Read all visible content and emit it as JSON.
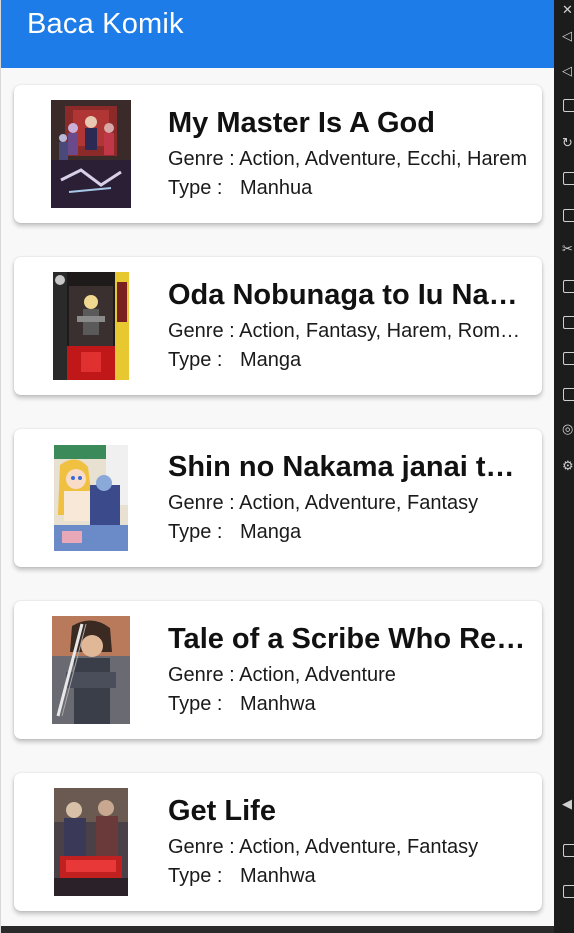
{
  "app": {
    "title": "Baca Komik",
    "accent_color": "#1e7ce8"
  },
  "labels": {
    "genre_prefix": "Genre : ",
    "type_label": "Type :"
  },
  "comics": [
    {
      "title": "My Master Is A God",
      "genre": "Action, Adventure, Ecchi, Harem",
      "type": "Manhua",
      "cover_icon": "cover-image-my-master-is-a-god"
    },
    {
      "title": "Oda Nobunaga to Iu Nazo no Shokugyou ga Mahou Kenshi yori Cheat datta node, Oukoku wo Tsukuru Koto ni Shimashita",
      "genre": "Action, Fantasy, Harem, Romance",
      "type": "Manga",
      "cover_icon": "cover-image-oda-nobunaga"
    },
    {
      "title": "Shin no Nakama janai to Yuusha no Party wo Oidasareta node",
      "genre": "Action, Adventure, Fantasy",
      "type": "Manga",
      "cover_icon": "cover-image-shin-no-nakama"
    },
    {
      "title": "Tale of a Scribe Who Retires to the Countryside",
      "genre": "Action, Adventure",
      "type": "Manhwa",
      "cover_icon": "cover-image-tale-of-a-scribe"
    },
    {
      "title": "Get Life",
      "genre": "Action, Adventure, Fantasy",
      "type": "Manhwa",
      "cover_icon": "cover-image-get-life"
    }
  ]
}
